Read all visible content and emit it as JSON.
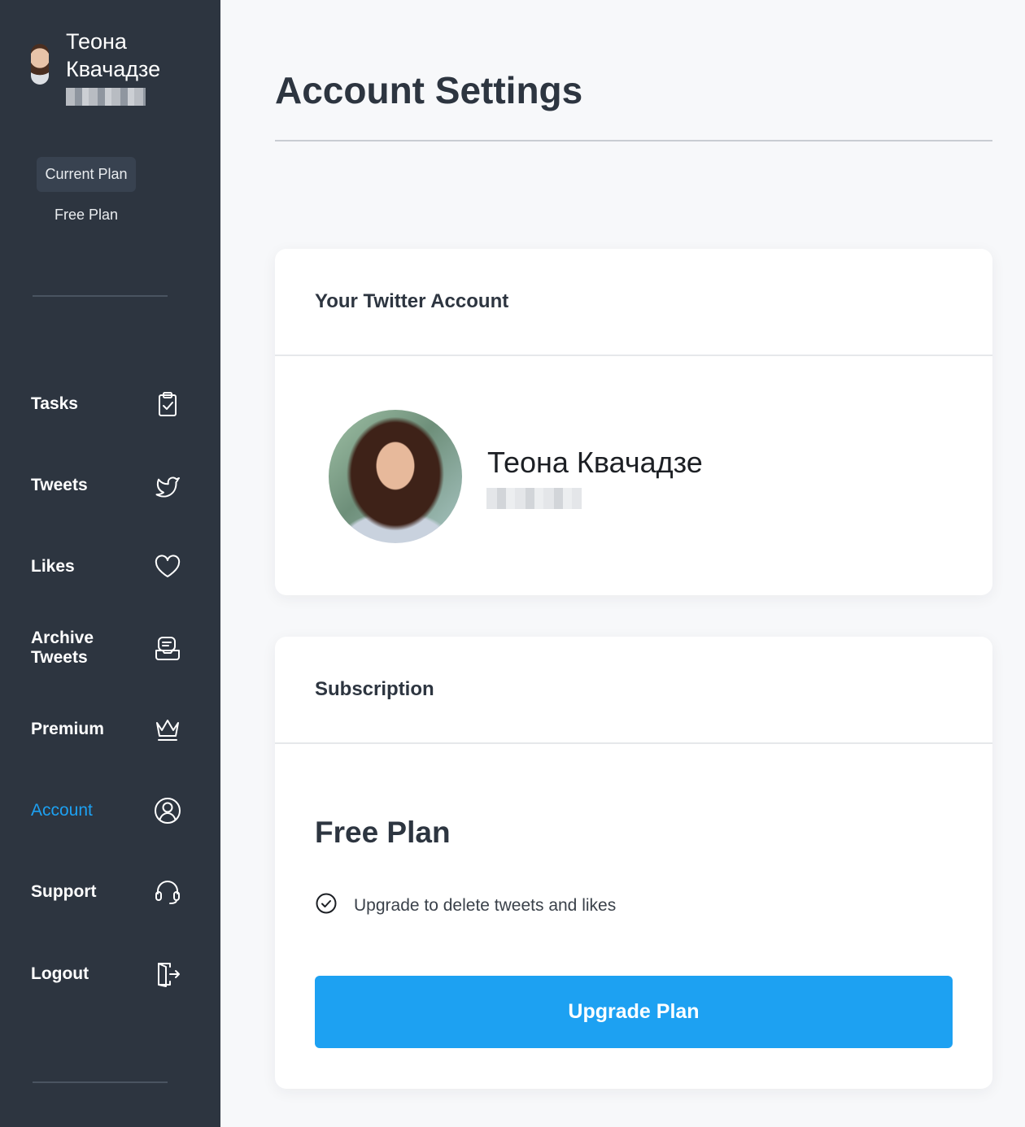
{
  "sidebar": {
    "profile": {
      "name": "Теона Квачадзе"
    },
    "current_plan_label": "Current Plan",
    "plan_name": "Free Plan",
    "nav": [
      {
        "label": "Tasks",
        "icon": "clipboard-check-icon"
      },
      {
        "label": "Tweets",
        "icon": "twitter-bird-icon"
      },
      {
        "label": "Likes",
        "icon": "heart-icon"
      },
      {
        "label": "Archive Tweets",
        "icon": "archive-icon"
      },
      {
        "label": "Premium",
        "icon": "crown-icon"
      },
      {
        "label": "Account",
        "icon": "user-circle-icon",
        "active": true
      },
      {
        "label": "Support",
        "icon": "headset-icon"
      },
      {
        "label": "Logout",
        "icon": "logout-door-icon"
      }
    ]
  },
  "main": {
    "title": "Account Settings",
    "twitter_card": {
      "heading": "Your Twitter Account",
      "name": "Теона Квачадзе"
    },
    "subscription_card": {
      "heading": "Subscription",
      "plan": "Free Plan",
      "features": [
        "Upgrade to delete tweets and likes"
      ],
      "button": "Upgrade Plan"
    }
  },
  "colors": {
    "sidebar_bg": "#2d3540",
    "accent": "#1da1f2",
    "page_bg": "#f7f8fa",
    "heading_text": "#2d3540"
  }
}
